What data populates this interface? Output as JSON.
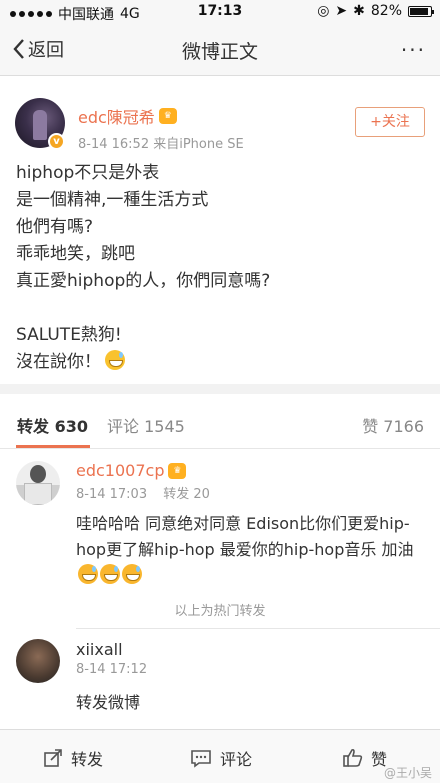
{
  "status_bar": {
    "carrier": "中国联通",
    "network": "4G",
    "time": "17:13",
    "battery": "82%",
    "battery_level": 0.82
  },
  "nav": {
    "back_label": "返回",
    "title": "微博正文",
    "more": "···"
  },
  "post": {
    "author": "edc陳冠希",
    "meta": "8-14 16:52  来自iPhone SE",
    "follow_label": "+关注",
    "lines": [
      "hiphop不只是外表",
      "是一個精神,一種生活方式",
      "他們有嗎?",
      "乖乖地笑，跳吧",
      "真正愛hiphop的人，你們同意嗎?",
      "",
      "SALUTE熱狗!",
      "沒在說你！"
    ]
  },
  "tabs": {
    "repost": "转发 630",
    "comment": "评论 1545",
    "like": "赞 7166"
  },
  "reposts": [
    {
      "name": "edc1007cp",
      "time": "8-14 17:03",
      "repost_count": "转发 20",
      "text": "哇哈哈哈 同意绝对同意 Edison比你们更爱hip-hop更了解hip-hop 最爱你的hip-hop音乐 加油"
    },
    {
      "name": "xiixall",
      "time": "8-14 17:12",
      "text": "转发微博"
    }
  ],
  "hot_separator": "以上为热门转发",
  "bottom_bar": {
    "repost": "转发",
    "comment": "评论",
    "like": "赞"
  },
  "watermark": "@王小吴",
  "colors": {
    "accent": "#eb7350",
    "background": "#f2f2f2"
  }
}
